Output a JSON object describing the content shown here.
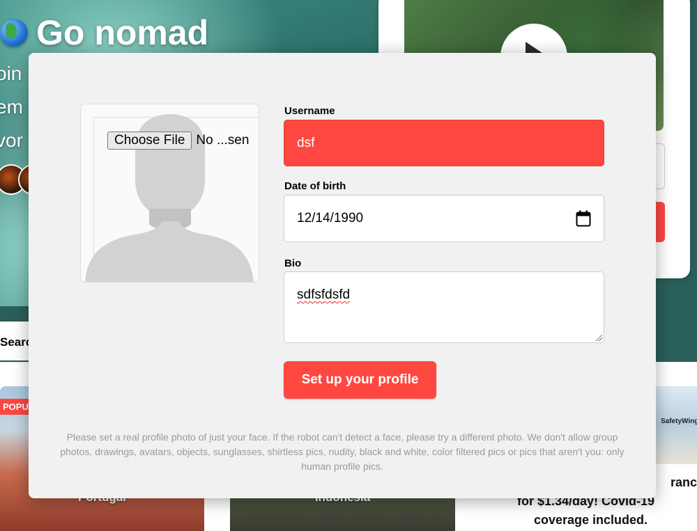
{
  "background": {
    "logo_text": "Go nomad",
    "side_lines": [
      "oin",
      "em",
      "vor"
    ],
    "search_label": "Searc",
    "popular_badge": "POPUL",
    "cards": [
      {
        "label": "Portugal"
      },
      {
        "label": "Indonesia"
      }
    ],
    "ad": {
      "logo": "SafetyWing",
      "text_lines": [
        "rance",
        "for $1.34/day! Covid-19",
        "coverage included."
      ]
    }
  },
  "modal": {
    "photo": {
      "choose_file_label": "Choose File",
      "file_status": "No ...sen"
    },
    "username": {
      "label": "Username",
      "value": "dsf",
      "state_color": "#ff4742"
    },
    "dob": {
      "label": "Date of birth",
      "value": "12/14/1990",
      "icon": "calendar-icon"
    },
    "bio": {
      "label": "Bio",
      "value": "sdfsfdsfd"
    },
    "submit_label": "Set up your profile",
    "note": "Please set a real profile photo of just your face. If the robot can't detect a face, please try a different photo. We don't allow group photos, drawings, avatars, objects, sunglasses, shirtless pics, nudity, black and white, color filtered pics or pics that aren't you: only human profile pics."
  },
  "colors": {
    "accent": "#ff4742",
    "modal_bg": "#f1f1f1"
  }
}
